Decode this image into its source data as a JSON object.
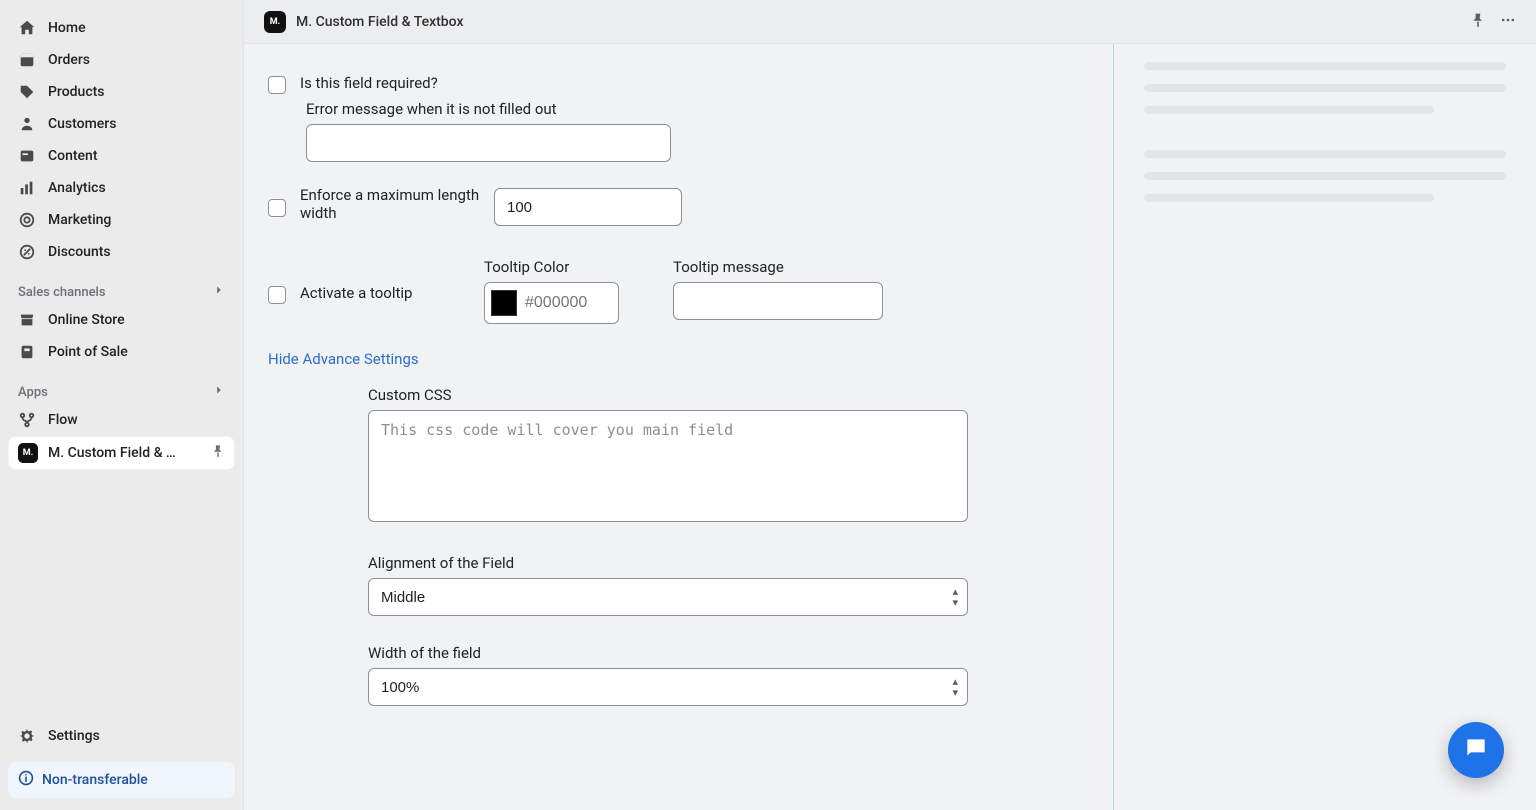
{
  "sidebar": {
    "nav": [
      {
        "label": "Home"
      },
      {
        "label": "Orders"
      },
      {
        "label": "Products"
      },
      {
        "label": "Customers"
      },
      {
        "label": "Content"
      },
      {
        "label": "Analytics"
      },
      {
        "label": "Marketing"
      },
      {
        "label": "Discounts"
      }
    ],
    "sales_channels_header": "Sales channels",
    "sales_channels": [
      {
        "label": "Online Store"
      },
      {
        "label": "Point of Sale"
      }
    ],
    "apps_header": "Apps",
    "apps": [
      {
        "label": "Flow"
      }
    ],
    "active_app_label": "M. Custom Field & Tex...",
    "settings_label": "Settings",
    "non_transferable_label": "Non-transferable"
  },
  "titlebar": {
    "title": "M. Custom Field & Textbox"
  },
  "form": {
    "required_label": "Is this field required?",
    "error_label": "Error message when it is not filled out",
    "error_value": "",
    "enforce_label": "Enforce a maximum length width",
    "maxlen_value": "100",
    "tooltip_activate_label": "Activate a tooltip",
    "tooltip_color_label": "Tooltip Color",
    "tooltip_color_placeholder": "#000000",
    "tooltip_message_label": "Tooltip message",
    "tooltip_message_value": "",
    "hide_advance_label": "Hide Advance Settings",
    "custom_css_label": "Custom CSS",
    "custom_css_placeholder": "This css code will cover you main field",
    "alignment_label": "Alignment of the Field",
    "alignment_value": "Middle",
    "width_label": "Width of the field",
    "width_value": "100%"
  }
}
